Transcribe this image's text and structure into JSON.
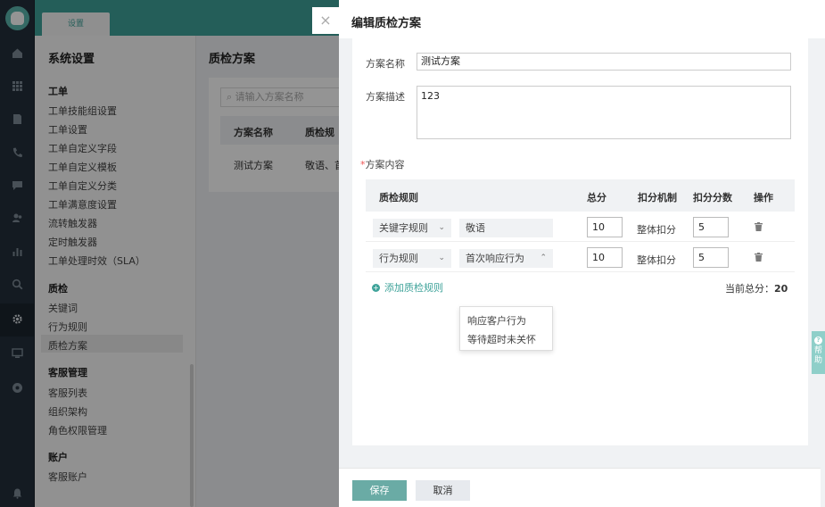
{
  "topbar": {
    "tab_label": "设置"
  },
  "sidenav": {
    "title": "系统设置",
    "groups": [
      {
        "label": "工单",
        "items": [
          "工单技能组设置",
          "工单设置",
          "工单自定义字段",
          "工单自定义模板",
          "工单自定义分类",
          "工单满意度设置",
          "流转触发器",
          "定时触发器",
          "工单处理时效（SLA）"
        ]
      },
      {
        "label": "质检",
        "items": [
          "关键词",
          "行为规则",
          "质检方案"
        ]
      },
      {
        "label": "客服管理",
        "items": [
          "客服列表",
          "组织架构",
          "角色权限管理"
        ]
      },
      {
        "label": "账户",
        "items": [
          "客服账户"
        ]
      }
    ],
    "active_item": "质检方案"
  },
  "main": {
    "title": "质检方案",
    "search_placeholder": "请输入方案名称",
    "columns": [
      "方案名称",
      "质检规"
    ],
    "row": [
      "测试方案",
      "敬语、首"
    ]
  },
  "drawer": {
    "close_icon": "×",
    "title": "编辑质检方案",
    "name_label": "方案名称",
    "name_value": "测试方案",
    "desc_label": "方案描述",
    "desc_value": "123",
    "content_required_mark": "*",
    "content_label": "方案内容",
    "table_headers": {
      "rule": "质检规则",
      "total": "总分",
      "mechanism": "扣分机制",
      "deduct": "扣分分数",
      "ops": "操作"
    },
    "rows": [
      {
        "type": "关键字规则",
        "rule": "敬语",
        "total": "10",
        "mechanism": "整体扣分",
        "deduct": "5"
      },
      {
        "type": "行为规则",
        "rule": "首次响应行为",
        "total": "10",
        "mechanism": "整体扣分",
        "deduct": "5"
      }
    ],
    "dropdown_options": [
      "响应客户行为",
      "等待超时未关怀"
    ],
    "add_rule_label": "添加质检规则",
    "total_label": "当前总分：",
    "total_value": "20",
    "save_label": "保存",
    "cancel_label": "取消"
  },
  "help_tab": {
    "label": "帮助"
  },
  "colors": {
    "brand": "#3fa39a",
    "rail": "#24303b",
    "save_button": "#6aaba5"
  },
  "icons": [
    "logo-icon",
    "home-icon",
    "grid-icon",
    "document-icon",
    "phone-icon",
    "chat-icon",
    "users-icon",
    "chart-icon",
    "search-icon",
    "gear-icon",
    "monitor-icon",
    "shield-icon",
    "bell-icon",
    "trash-icon",
    "plus-circle-icon",
    "question-icon"
  ]
}
